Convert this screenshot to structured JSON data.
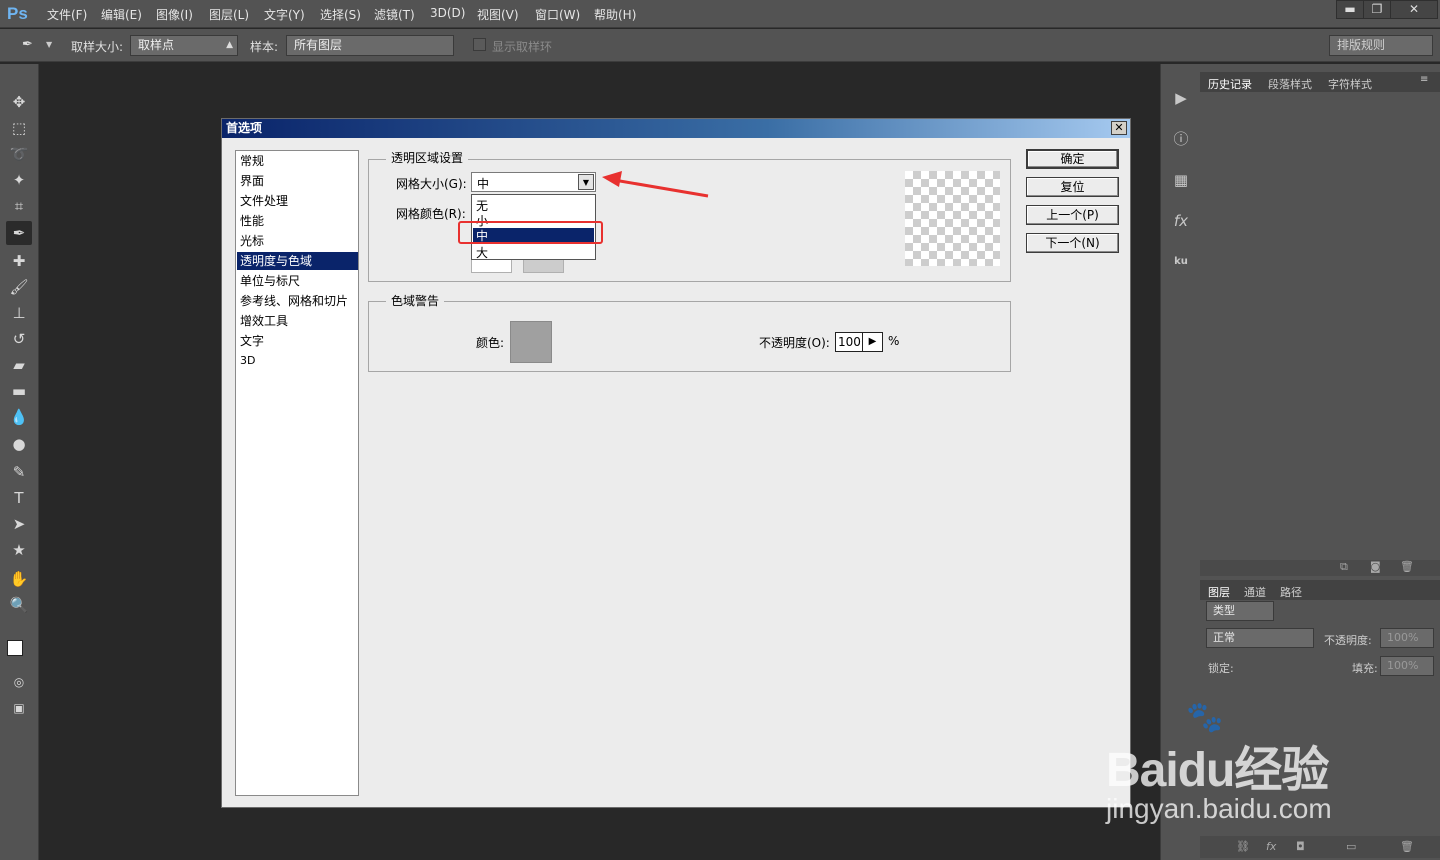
{
  "app": {
    "logo": "Ps"
  },
  "menubar": {
    "items": [
      "文件(F)",
      "编辑(E)",
      "图像(I)",
      "图层(L)",
      "文字(Y)",
      "选择(S)",
      "滤镜(T)",
      "3D(D)",
      "视图(V)",
      "窗口(W)",
      "帮助(H)"
    ]
  },
  "window_controls": {
    "minimize": "▬",
    "restore": "❐",
    "close": "✕"
  },
  "options_bar": {
    "sample_size_label": "取样大小:",
    "sample_size_value": "取样点",
    "sample_label": "样本:",
    "sample_value": "所有图层",
    "show_ring_label": "显示取样环",
    "workspace_value": "排版规则"
  },
  "toolbar": {
    "icons": [
      "move-icon",
      "marquee-icon",
      "lasso-icon",
      "magic-wand-icon",
      "crop-icon",
      "eyedropper-icon",
      "healing-brush-icon",
      "brush-icon",
      "clone-stamp-icon",
      "history-brush-icon",
      "eraser-icon",
      "gradient-icon",
      "blur-icon",
      "dodge-icon",
      "pen-icon",
      "type-icon",
      "path-selection-icon",
      "shape-icon",
      "hand-icon",
      "zoom-icon"
    ]
  },
  "dock": {
    "icons": [
      "play-icon",
      "info-icon",
      "grid-icon",
      "fx-icon",
      "ku-icon"
    ]
  },
  "right_panel": {
    "top_tabs": [
      "历史记录",
      "段落样式",
      "字符样式"
    ],
    "layer_tabs": [
      "图层",
      "通道",
      "路径"
    ],
    "filter_kind": "类型",
    "blend_mode": "正常",
    "opacity_label": "不透明度:",
    "opacity_value": "100%",
    "lock_label": "锁定:",
    "fill_label": "填充:",
    "fill_value": "100%"
  },
  "dialog": {
    "title": "首选项",
    "categories": [
      "常规",
      "界面",
      "文件处理",
      "性能",
      "光标",
      "透明度与色域",
      "单位与标尺",
      "参考线、网格和切片",
      "增效工具",
      "文字",
      "3D"
    ],
    "selected_category": "透明度与色域",
    "transparency_group": "透明区域设置",
    "grid_size_label": "网格大小(G):",
    "grid_size_value": "中",
    "grid_color_label": "网格颜色(R):",
    "grid_size_options": [
      "无",
      "小",
      "中",
      "大"
    ],
    "highlighted_option": "中",
    "gamut_group": "色域警告",
    "color_label": "颜色:",
    "opacity_label": "不透明度(O):",
    "opacity_value": "100",
    "percent": "%",
    "buttons": {
      "ok": "确定",
      "reset": "复位",
      "prev": "上一个(P)",
      "next": "下一个(N)"
    }
  },
  "watermark": {
    "brand": "Baidu经验",
    "url": "jingyan.baidu.com"
  },
  "colors": {
    "annotation_red": "#e8312f",
    "selection_blue": "#0a246a",
    "gamut_gray": "#a0a0a0"
  }
}
